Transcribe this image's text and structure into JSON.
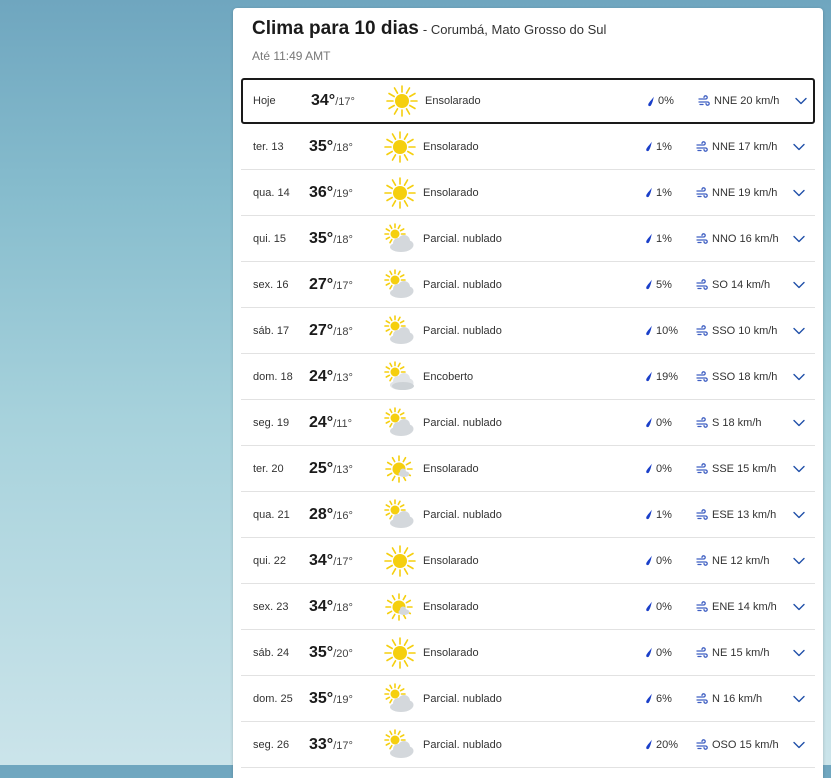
{
  "header": {
    "title": "Clima para 10 dias",
    "location": "- Corumbá, Mato Grosso do Sul",
    "updated": "Até 11:49 AMT"
  },
  "days": [
    {
      "day": "Hoje",
      "hi": "34°",
      "lo": "/17°",
      "icon": "sunny-icon",
      "condition": "Ensolarado",
      "precip": "0%",
      "wind": "NNE 20 km/h",
      "selected": true
    },
    {
      "day": "ter. 13",
      "hi": "35°",
      "lo": "/18°",
      "icon": "sunny-icon",
      "condition": "Ensolarado",
      "precip": "1%",
      "wind": "NNE 17 km/h"
    },
    {
      "day": "qua. 14",
      "hi": "36°",
      "lo": "/19°",
      "icon": "sunny-icon",
      "condition": "Ensolarado",
      "precip": "1%",
      "wind": "NNE 19 km/h"
    },
    {
      "day": "qui. 15",
      "hi": "35°",
      "lo": "/18°",
      "icon": "partly-cloudy-icon",
      "condition": "Parcial. nublado",
      "precip": "1%",
      "wind": "NNO 16 km/h"
    },
    {
      "day": "sex. 16",
      "hi": "27°",
      "lo": "/17°",
      "icon": "partly-cloudy-icon",
      "condition": "Parcial. nublado",
      "precip": "5%",
      "wind": "SO 14 km/h"
    },
    {
      "day": "sáb. 17",
      "hi": "27°",
      "lo": "/18°",
      "icon": "partly-cloudy-icon",
      "condition": "Parcial. nublado",
      "precip": "10%",
      "wind": "SSO 10 km/h"
    },
    {
      "day": "dom. 18",
      "hi": "24°",
      "lo": "/13°",
      "icon": "overcast-icon",
      "condition": "Encoberto",
      "precip": "19%",
      "wind": "SSO 18 km/h"
    },
    {
      "day": "seg. 19",
      "hi": "24°",
      "lo": "/11°",
      "icon": "partly-cloudy-icon",
      "condition": "Parcial. nublado",
      "precip": "0%",
      "wind": "S 18 km/h"
    },
    {
      "day": "ter. 20",
      "hi": "25°",
      "lo": "/13°",
      "icon": "mostly-sunny-icon",
      "condition": "Ensolarado",
      "precip": "0%",
      "wind": "SSE 15 km/h"
    },
    {
      "day": "qua. 21",
      "hi": "28°",
      "lo": "/16°",
      "icon": "partly-cloudy-icon",
      "condition": "Parcial. nublado",
      "precip": "1%",
      "wind": "ESE 13 km/h"
    },
    {
      "day": "qui. 22",
      "hi": "34°",
      "lo": "/17°",
      "icon": "sunny-icon",
      "condition": "Ensolarado",
      "precip": "0%",
      "wind": "NE 12 km/h"
    },
    {
      "day": "sex. 23",
      "hi": "34°",
      "lo": "/18°",
      "icon": "mostly-sunny-icon",
      "condition": "Ensolarado",
      "precip": "0%",
      "wind": "ENE 14 km/h"
    },
    {
      "day": "sáb. 24",
      "hi": "35°",
      "lo": "/20°",
      "icon": "sunny-icon",
      "condition": "Ensolarado",
      "precip": "0%",
      "wind": "NE 15 km/h"
    },
    {
      "day": "dom. 25",
      "hi": "35°",
      "lo": "/19°",
      "icon": "partly-cloudy-icon",
      "condition": "Parcial. nublado",
      "precip": "6%",
      "wind": "N 16 km/h"
    },
    {
      "day": "seg. 26",
      "hi": "33°",
      "lo": "/17°",
      "icon": "partly-cloudy-icon",
      "condition": "Parcial. nublado",
      "precip": "20%",
      "wind": "OSO 15 km/h"
    }
  ],
  "colors": {
    "sun": "#f5cf0f",
    "cloud": "#d4d8dc",
    "rain_drop": "#1a3fc9",
    "wind_icon": "#3f5fc2",
    "chevron": "#1f4fa8"
  }
}
